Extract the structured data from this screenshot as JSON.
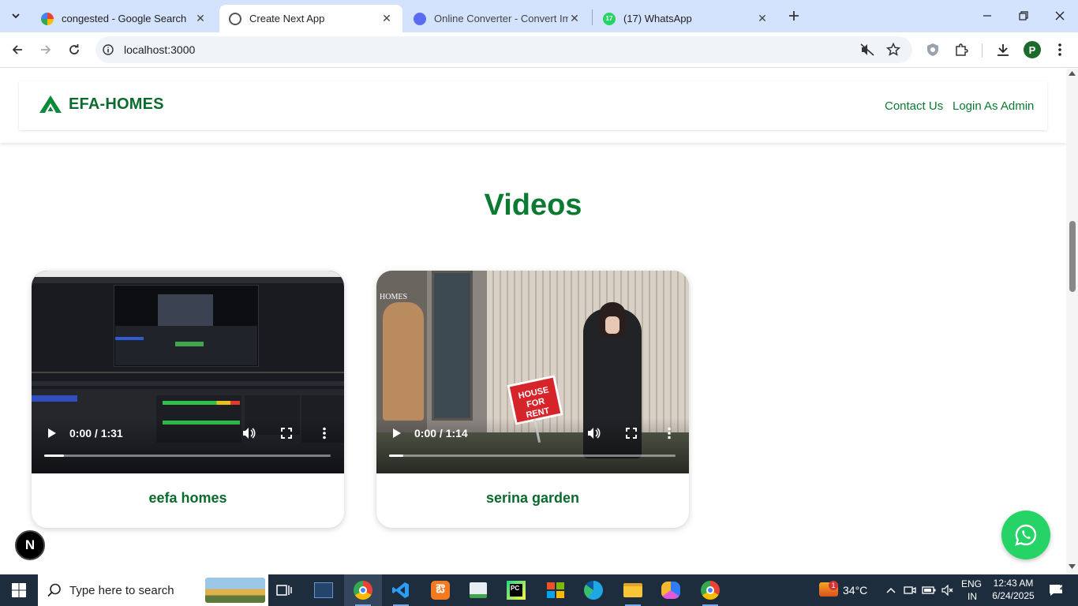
{
  "browser": {
    "tabs": [
      {
        "title": "congested - Google Search",
        "active": false
      },
      {
        "title": "Create Next App",
        "active": true
      },
      {
        "title": "Online Converter - Convert Ima",
        "active": false
      },
      {
        "title": "(17) WhatsApp",
        "active": false
      }
    ],
    "whatsapp_badge": "17",
    "url": "localhost:3000",
    "profile_initial": "P"
  },
  "site": {
    "brand": "EFA-HOMES",
    "nav": {
      "contact": "Contact Us",
      "login": "Login As Admin"
    },
    "section_title": "Videos",
    "videos": [
      {
        "title": "eefa homes",
        "time": "0:00 / 1:31",
        "progress": 0.07
      },
      {
        "title": "serina garden",
        "time": "0:00 / 1:14",
        "progress": 0.05
      }
    ],
    "video2_sign": "HOUSE FOR RENT",
    "video2_overlay": "HOMES",
    "nextjs_badge": "N"
  },
  "taskbar": {
    "search_placeholder": "Type here to search",
    "weather": "34°C",
    "weather_badge": "1",
    "lang_top": "ENG",
    "lang_bottom": "IN",
    "time": "12:43 AM",
    "date": "6/24/2025",
    "notif_count": "2"
  }
}
